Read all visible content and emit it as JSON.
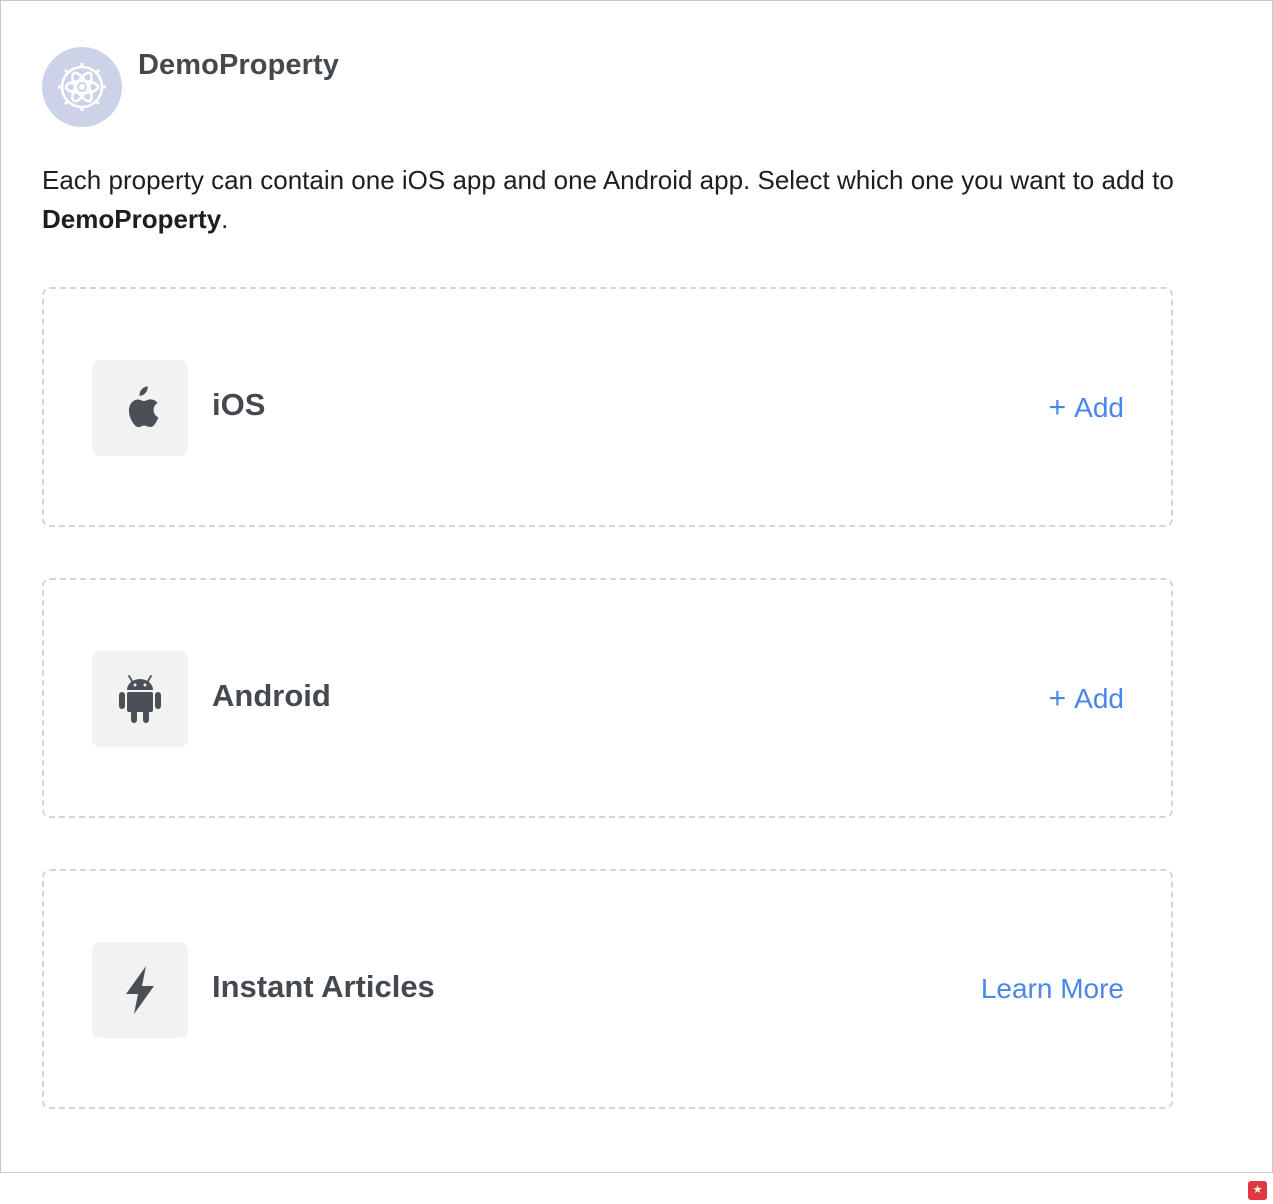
{
  "property": {
    "name": "DemoProperty",
    "avatar_icon": "atom-gear-icon",
    "avatar_color": "#ccd3e8"
  },
  "description": {
    "text_before": "Each property can contain one iOS app and one Android app. Select which one you want to add to ",
    "property_name": "DemoProperty",
    "text_after": "."
  },
  "cards": [
    {
      "title": "iOS",
      "icon": "apple-icon",
      "action_plus": "+",
      "action_label": "Add"
    },
    {
      "title": "Android",
      "icon": "android-icon",
      "action_plus": "+",
      "action_label": "Add"
    },
    {
      "title": "Instant Articles",
      "icon": "lightning-bolt-icon",
      "action_label": "Learn More"
    }
  ],
  "colors": {
    "link": "#4a86e8",
    "title": "#444950",
    "dashed_border": "#d3d5d9",
    "icon_tile": "#f2f2f3",
    "badge": "#e0383e"
  },
  "corner_badge": {
    "icon": "star-badge-icon",
    "glyph": "★"
  }
}
